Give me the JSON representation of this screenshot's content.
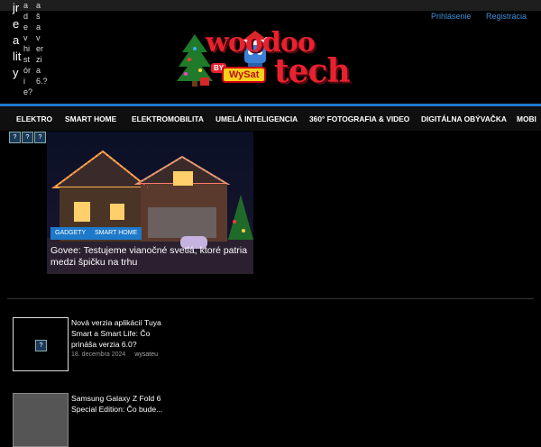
{
  "header": {
    "login": "Prihlásenie",
    "register": "Registrácia",
    "logo": {
      "part1": "woodoo",
      "part2": "tech",
      "by": "BY",
      "brand": "WySat"
    }
  },
  "glitch_columns": [
    "jrealit y",
    "adevhistórie?",
    "ašaverzia6.?"
  ],
  "nav": {
    "items": [
      "ELEKTRO",
      "SMART HOME",
      "ELEKTROMOBILITA",
      "UMELÁ INTELIGENCIA",
      "360° FOTOGRAFIA & VIDEO",
      "DIGITÁLNA OBÝVAČKA",
      "MOBI"
    ]
  },
  "featured": {
    "tags": [
      "GADGETY",
      "SMART HOME"
    ],
    "title": "Govee: Testujeme vianočné svetlá, ktoré patria medzi špičku na trhu"
  },
  "articles": [
    {
      "title": "Nová verzia aplikácií Tuya Smart a Smart Life: Čo prináša verzia 6.0?",
      "date": "18. decembra 2024",
      "author": "wysateu"
    },
    {
      "title": "Samsung Galaxy Z Fold 6 Special Edition: Čo bude...",
      "date": "",
      "author": ""
    }
  ],
  "colors": {
    "accent": "#1d79c9",
    "logo_red": "#e8212f"
  }
}
